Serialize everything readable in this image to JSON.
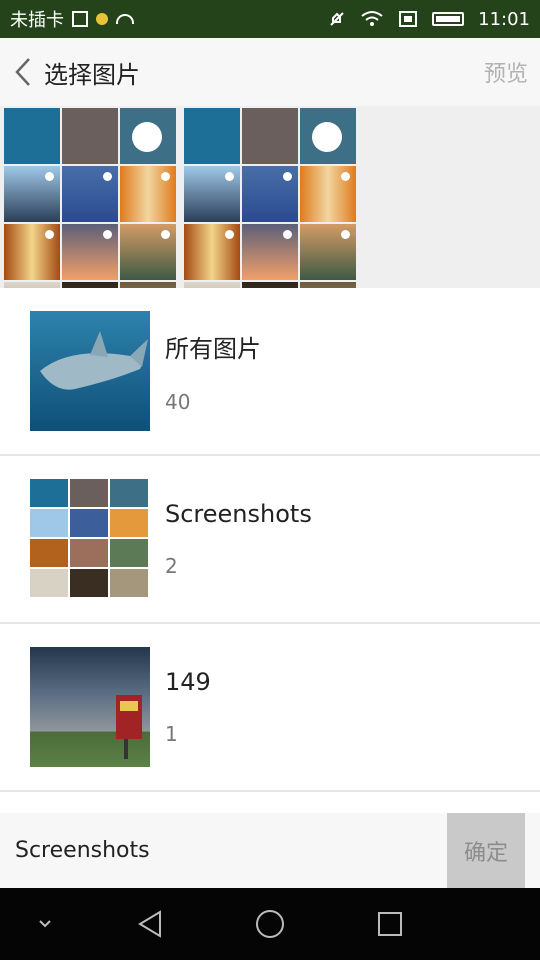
{
  "status_bar": {
    "carrier": "未插卡",
    "time": "11:01",
    "icons": [
      "sim-icon",
      "notification-dot-icon",
      "android-icon",
      "mute-icon",
      "wifi-icon",
      "sim-card-icon",
      "battery-icon"
    ]
  },
  "header": {
    "back_icon": "chevron-left-icon",
    "title": "选择图片",
    "preview_label": "预览"
  },
  "albums": [
    {
      "name": "所有图片",
      "count": "40"
    },
    {
      "name": "Screenshots",
      "count": "2"
    },
    {
      "name": "149",
      "count": "1"
    }
  ],
  "bottom_bar": {
    "selected_album": "Screenshots",
    "confirm_label": "确定"
  },
  "nav_bar": {
    "icons": [
      "collapse-icon",
      "back-triangle-icon",
      "home-circle-icon",
      "recents-square-icon"
    ]
  },
  "colors": {
    "status_bg": "#24431a",
    "header_bg": "#f7f7f7",
    "confirm_bg": "#c9c9c9",
    "nav_bg": "#050505"
  }
}
